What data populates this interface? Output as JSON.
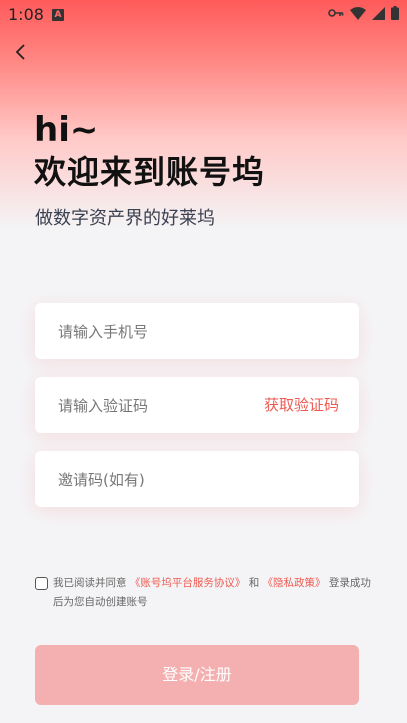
{
  "status_bar": {
    "time": "1:08",
    "app_badge": "A"
  },
  "header": {
    "greeting": "hi~",
    "welcome": "欢迎来到账号坞",
    "subtitle": "做数字资产界的好莱坞"
  },
  "form": {
    "phone_placeholder": "请输入手机号",
    "code_placeholder": "请输入验证码",
    "get_code_label": "获取验证码",
    "invite_placeholder": "邀请码(如有)"
  },
  "agreement": {
    "checked": false,
    "prefix": "我已阅读并同意",
    "terms_link": "《账号坞平台服务协议》",
    "and": "和",
    "privacy_link": "《隐私政策》",
    "suffix": "登录成功后为您自动创建账号"
  },
  "login_button": {
    "label": "登录/注册"
  },
  "colors": {
    "accent": "#ee5a52",
    "button_disabled": "#f4b0b0",
    "gradient_top": "#ff5a5a"
  },
  "icons": [
    "key-icon",
    "wifi-icon",
    "signal-icon",
    "battery-icon",
    "back-arrow-icon"
  ]
}
